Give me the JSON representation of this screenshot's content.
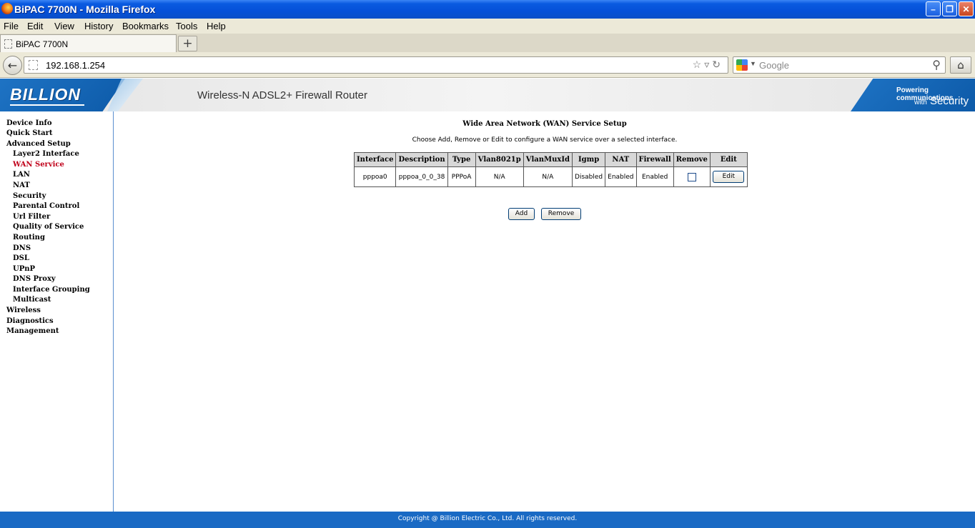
{
  "window": {
    "title": "BiPAC 7700N - Mozilla Firefox"
  },
  "menu": [
    "File",
    "Edit",
    "View",
    "History",
    "Bookmarks",
    "Tools",
    "Help"
  ],
  "tab": {
    "label": "BiPAC 7700N",
    "new_tab": "+"
  },
  "address": {
    "url": "192.168.1.254",
    "search_placeholder": "Google"
  },
  "banner": {
    "logo": "BILLION",
    "product": "Wireless-N ADSL2+ Firewall Router",
    "slogan_line1": "Powering communications",
    "slogan_with": "with",
    "slogan_line2": "Security"
  },
  "sidebar": {
    "device_info": "Device Info",
    "quick_start": "Quick Start",
    "advanced_setup": "Advanced Setup",
    "layer2_interface": "Layer2 Interface",
    "wan_service": "WAN Service",
    "lan": "LAN",
    "nat": "NAT",
    "security": "Security",
    "parental_control": "Parental Control",
    "url_filter": "Url Filter",
    "quality_of_service": "Quality of Service",
    "routing": "Routing",
    "dns": "DNS",
    "dsl": "DSL",
    "upnp": "UPnP",
    "dns_proxy": "DNS Proxy",
    "interface_grouping": "Interface Grouping",
    "multicast": "Multicast",
    "wireless": "Wireless",
    "diagnostics": "Diagnostics",
    "management": "Management"
  },
  "main": {
    "heading": "Wide Area Network (WAN) Service Setup",
    "description": "Choose Add, Remove or Edit to configure a WAN service over a selected interface.",
    "columns": {
      "interface": "Interface",
      "description": "Description",
      "type": "Type",
      "vlan8021p": "Vlan8021p",
      "vlanmuxid": "VlanMuxId",
      "igmp": "Igmp",
      "nat": "NAT",
      "firewall": "Firewall",
      "remove": "Remove",
      "edit": "Edit"
    },
    "row": {
      "interface": "pppoa0",
      "description": "pppoa_0_0_38",
      "type": "PPPoA",
      "vlan8021p": "N/A",
      "vlanmuxid": "N/A",
      "igmp": "Disabled",
      "nat": "Enabled",
      "firewall": "Enabled",
      "edit_label": "Edit"
    },
    "add_label": "Add",
    "remove_label": "Remove"
  },
  "footer": {
    "copyright": "Copyright @ Billion Electric Co., Ltd. All rights reserved."
  }
}
